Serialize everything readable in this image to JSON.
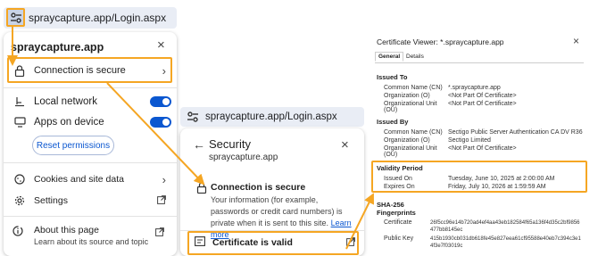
{
  "panel1": {
    "url": "spraycapture.app/Login.aspx",
    "site": "spraycapture.app",
    "close": "×",
    "connection": "Connection is secure",
    "local_network": "Local network",
    "apps_on_device": "Apps on device",
    "reset": "Reset permissions",
    "cookies": "Cookies and site data",
    "settings": "Settings",
    "about_title": "About this page",
    "about_sub": "Learn about its source and topic"
  },
  "panel2": {
    "url": "spraycapture.app/Login.aspx",
    "title": "Security",
    "site": "spraycapture.app",
    "close": "×",
    "back": "←",
    "secure_title": "Connection is secure",
    "secure_body": "Your information (for example, passwords or credit card numbers) is private when it is sent to this site.",
    "learn_more": "Learn more",
    "cert_valid": "Certificate is valid"
  },
  "viewer": {
    "title": "Certificate Viewer: *.spraycapture.app",
    "close": "×",
    "tabs": [
      "General",
      "Details"
    ],
    "issued_to": {
      "heading": "Issued To",
      "rows": [
        {
          "label": "Common Name (CN)",
          "value": "*.spraycapture.app"
        },
        {
          "label": "Organization (O)",
          "value": "<Not Part Of Certificate>"
        },
        {
          "label": "Organizational Unit (OU)",
          "value": "<Not Part Of Certificate>"
        }
      ]
    },
    "issued_by": {
      "heading": "Issued By",
      "rows": [
        {
          "label": "Common Name (CN)",
          "value": "Sectigo Public Server Authentication CA DV R36"
        },
        {
          "label": "Organization (O)",
          "value": "Sectigo Limited"
        },
        {
          "label": "Organizational Unit (OU)",
          "value": "<Not Part Of Certificate>"
        }
      ]
    },
    "validity": {
      "heading": "Validity Period",
      "rows": [
        {
          "label": "Issued On",
          "value": "Tuesday, June 10, 2025 at 2:00:00 AM"
        },
        {
          "label": "Expires On",
          "value": "Friday, July 10, 2026 at 1:59:59 AM"
        }
      ]
    },
    "sha_heading": "SHA-256",
    "fingerprints_heading": "Fingerprints",
    "fingerprints": [
      {
        "label": "Certificate",
        "value_line1": "26f5cc96e14b720ad4ef4aa43eb182584f65a136f4d35c2bf9856",
        "value_line2": "477bb8145ec"
      },
      {
        "label": "Public Key",
        "value_line1": "415b1930cb031db618fe45e827eea61cf95588e40eb7c394c3e1",
        "value_line2": "4f3e7f03019c"
      }
    ]
  },
  "colors": {
    "accent": "#f5a623",
    "toggle_on": "#0b57d0",
    "link": "#0b57d0"
  }
}
